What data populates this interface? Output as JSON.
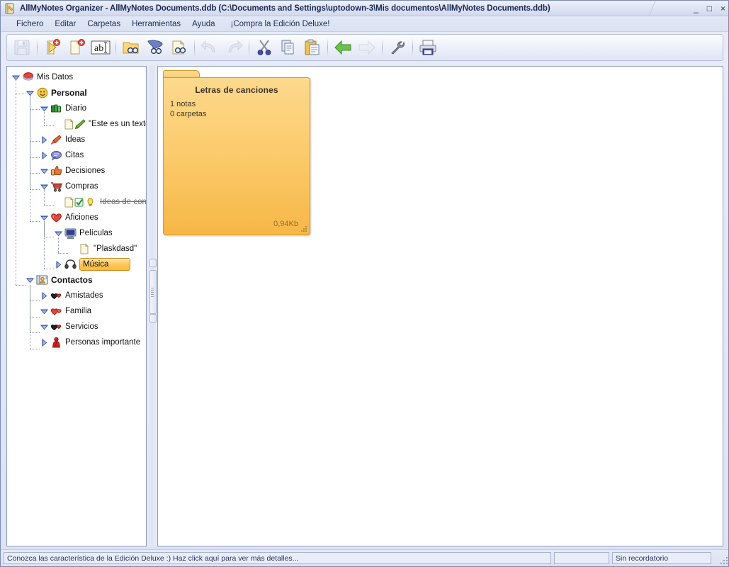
{
  "window": {
    "title": "AllMyNotes Organizer - AllMyNotes Documents.ddb (C:\\Documents and Settings\\uptodown-3\\Mis documentos\\AllMyNotes Documents.ddb)",
    "app_icon": "notebook-icon",
    "controls": {
      "minimize": "_",
      "maximize": "□",
      "close": "×"
    }
  },
  "menubar": {
    "items": [
      {
        "label": "Fichero",
        "name": "menu-fichero"
      },
      {
        "label": "Editar",
        "name": "menu-editar"
      },
      {
        "label": "Carpetas",
        "name": "menu-carpetas"
      },
      {
        "label": "Herramientas",
        "name": "menu-herramientas"
      },
      {
        "label": "Ayuda",
        "name": "menu-ayuda"
      },
      {
        "label": "¡Compra la Edición Deluxe!",
        "name": "menu-compra-deluxe"
      }
    ]
  },
  "toolbar": {
    "buttons": [
      {
        "name": "save-icon",
        "tip": "Guardar",
        "enabled": false
      },
      {
        "name": "new-note-icon",
        "tip": "Nueva nota",
        "enabled": true
      },
      {
        "name": "new-folder-icon",
        "tip": "Nueva carpeta",
        "enabled": true
      },
      {
        "name": "rename-icon",
        "tip": "Renombrar",
        "enabled": true
      },
      {
        "name": "find-in-folder-icon",
        "tip": "Buscar en carpeta",
        "enabled": true
      },
      {
        "name": "advanced-search-icon",
        "tip": "Búsqueda avanzada",
        "enabled": true
      },
      {
        "name": "find-next-icon",
        "tip": "Buscar siguiente",
        "enabled": true
      },
      {
        "name": "undo-icon",
        "tip": "Deshacer",
        "enabled": false
      },
      {
        "name": "redo-icon",
        "tip": "Rehacer",
        "enabled": false
      },
      {
        "name": "cut-icon",
        "tip": "Cortar",
        "enabled": true
      },
      {
        "name": "copy-icon",
        "tip": "Copiar",
        "enabled": true
      },
      {
        "name": "paste-icon",
        "tip": "Pegar",
        "enabled": true
      },
      {
        "name": "back-arrow-icon",
        "tip": "Atrás",
        "enabled": true
      },
      {
        "name": "forward-arrow-icon",
        "tip": "Adelante",
        "enabled": false
      },
      {
        "name": "options-wrench-icon",
        "tip": "Opciones",
        "enabled": true
      },
      {
        "name": "print-icon",
        "tip": "Imprimir",
        "enabled": true
      }
    ]
  },
  "tree": {
    "nodes": [
      {
        "label": "Mis Datos",
        "icon": "database-icon",
        "depth": 0,
        "expander": "expanded",
        "bold": false,
        "selected": false,
        "strike": false
      },
      {
        "label": "Personal",
        "icon": "smiley-icon",
        "depth": 1,
        "expander": "expanded",
        "bold": true,
        "selected": false,
        "strike": false
      },
      {
        "label": "Diario",
        "icon": "books-icon",
        "depth": 2,
        "expander": "expanded",
        "bold": false,
        "selected": false,
        "strike": false
      },
      {
        "label": "\"Este es un texto de",
        "icon": "note-pencil-icon",
        "depth": 3,
        "expander": "none",
        "bold": false,
        "selected": false,
        "strike": false
      },
      {
        "label": "Ideas",
        "icon": "hand-point-icon",
        "depth": 2,
        "expander": "collapsed",
        "bold": false,
        "selected": false,
        "strike": false
      },
      {
        "label": "Citas",
        "icon": "speech-icon",
        "depth": 2,
        "expander": "collapsed",
        "bold": false,
        "selected": false,
        "strike": false
      },
      {
        "label": "Decisiones",
        "icon": "thumbsup-icon",
        "depth": 2,
        "expander": "expanded",
        "bold": false,
        "selected": false,
        "strike": false
      },
      {
        "label": "Compras",
        "icon": "cart-icon",
        "depth": 2,
        "expander": "expanded",
        "bold": false,
        "selected": false,
        "strike": false
      },
      {
        "label": "Ideas de compra",
        "icon": "note-check-bulb-icon",
        "depth": 3,
        "expander": "none",
        "bold": false,
        "selected": false,
        "strike": true
      },
      {
        "label": "Aficiones",
        "icon": "heart-icon",
        "depth": 2,
        "expander": "expanded",
        "bold": false,
        "selected": false,
        "strike": false
      },
      {
        "label": "Películas",
        "icon": "monitor-icon",
        "depth": 3,
        "expander": "expanded",
        "bold": false,
        "selected": false,
        "strike": false
      },
      {
        "label": "\"Plaskdasd\"",
        "icon": "note-icon",
        "depth": 4,
        "expander": "none",
        "bold": false,
        "selected": false,
        "strike": false
      },
      {
        "label": "Música",
        "icon": "headphones-icon",
        "depth": 3,
        "expander": "collapsed",
        "bold": false,
        "selected": true,
        "strike": false
      },
      {
        "label": "Contactos",
        "icon": "contacts-icon",
        "depth": 1,
        "expander": "expanded",
        "bold": true,
        "selected": false,
        "strike": false
      },
      {
        "label": "Amistades",
        "icon": "hearts-dark-icon",
        "depth": 2,
        "expander": "collapsed",
        "bold": false,
        "selected": false,
        "strike": false
      },
      {
        "label": "Familia",
        "icon": "hearts-red-icon",
        "depth": 2,
        "expander": "expanded",
        "bold": false,
        "selected": false,
        "strike": false
      },
      {
        "label": "Servicios",
        "icon": "hearts-dark-icon",
        "depth": 2,
        "expander": "expanded",
        "bold": false,
        "selected": false,
        "strike": false
      },
      {
        "label": "Personas importante",
        "icon": "person-red-icon",
        "depth": 2,
        "expander": "collapsed",
        "bold": false,
        "selected": false,
        "strike": false
      }
    ]
  },
  "content": {
    "folder_card": {
      "title": "Letras de canciones",
      "notes_count": "1 notas",
      "folders_count": "0 carpetas",
      "size": "0,94Kb"
    }
  },
  "statusbar": {
    "message": "Conozca las característica de la Edición Deluxe :) Haz click aquí para ver más detalles...",
    "middle": "",
    "reminder": "Sin recordatorio"
  },
  "colors": {
    "accent_orange": "#f7b747",
    "card_border": "#d39a2c",
    "chrome_blue": "#dde3f3",
    "title_text": "#1b2a55"
  }
}
